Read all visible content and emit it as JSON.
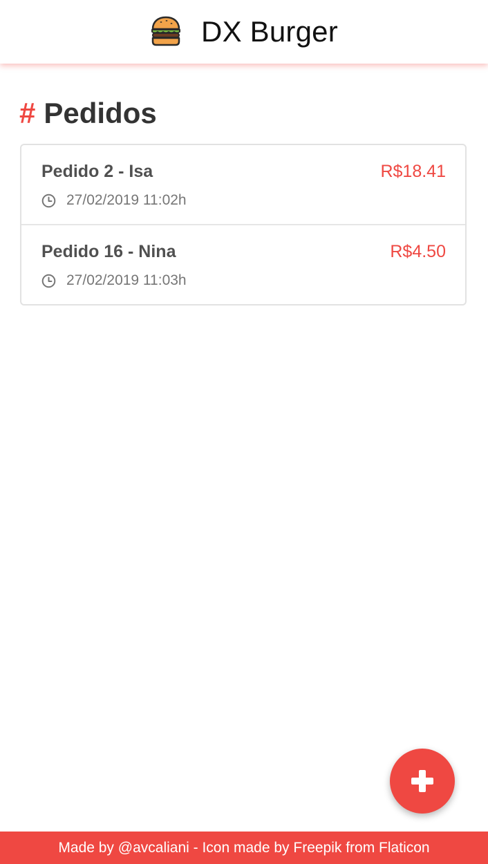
{
  "header": {
    "title": "DX Burger",
    "logo_icon": "burger-icon"
  },
  "main": {
    "title_prefix": "#",
    "title": "Pedidos",
    "orders": [
      {
        "name": "Pedido 2 - Isa",
        "price": "R$18.41",
        "time": "27/02/2019 11:02h"
      },
      {
        "name": "Pedido 16 - Nina",
        "price": "R$4.50",
        "time": "27/02/2019 11:03h"
      }
    ]
  },
  "fab": {
    "icon": "plus-icon"
  },
  "footer": {
    "text": "Made by @avcaliani - Icon made by Freepik from Flaticon"
  },
  "colors": {
    "accent": "#ef4842",
    "text_dark": "#333333",
    "text_muted": "#767676"
  }
}
